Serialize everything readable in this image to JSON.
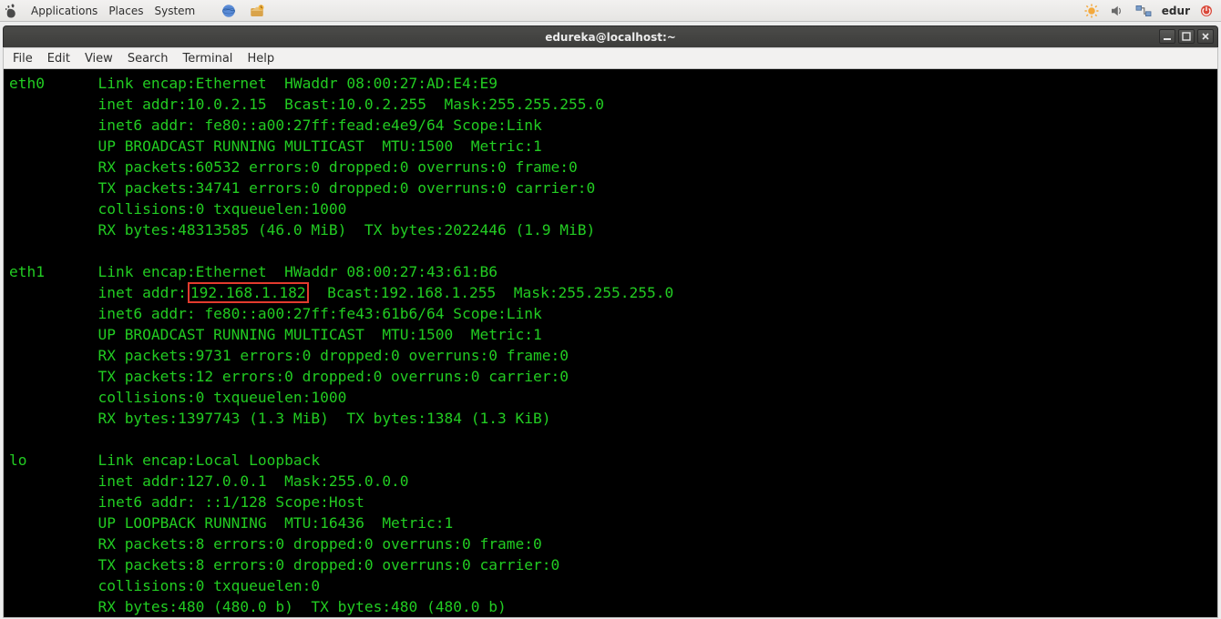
{
  "panel": {
    "menus": {
      "applications": "Applications",
      "places": "Places",
      "system": "System"
    },
    "user": "edur"
  },
  "window": {
    "title": "edureka@localhost:~",
    "menubar": {
      "file": "File",
      "edit": "Edit",
      "view": "View",
      "search": "Search",
      "terminal": "Terminal",
      "help": "Help"
    }
  },
  "highlight_ip": "192.168.1.182",
  "ifaces": [
    {
      "name": "eth0",
      "lines": [
        "Link encap:Ethernet  HWaddr 08:00:27:AD:E4:E9",
        "inet addr:10.0.2.15  Bcast:10.0.2.255  Mask:255.255.255.0",
        "inet6 addr: fe80::a00:27ff:fead:e4e9/64 Scope:Link",
        "UP BROADCAST RUNNING MULTICAST  MTU:1500  Metric:1",
        "RX packets:60532 errors:0 dropped:0 overruns:0 frame:0",
        "TX packets:34741 errors:0 dropped:0 overruns:0 carrier:0",
        "collisions:0 txqueuelen:1000",
        "RX bytes:48313585 (46.0 MiB)  TX bytes:2022446 (1.9 MiB)"
      ]
    },
    {
      "name": "eth1",
      "lines": [
        "Link encap:Ethernet  HWaddr 08:00:27:43:61:B6",
        {
          "pre": "inet addr:",
          "hl": "192.168.1.182",
          "post": "  Bcast:192.168.1.255  Mask:255.255.255.0"
        },
        "inet6 addr: fe80::a00:27ff:fe43:61b6/64 Scope:Link",
        "UP BROADCAST RUNNING MULTICAST  MTU:1500  Metric:1",
        "RX packets:9731 errors:0 dropped:0 overruns:0 frame:0",
        "TX packets:12 errors:0 dropped:0 overruns:0 carrier:0",
        "collisions:0 txqueuelen:1000",
        "RX bytes:1397743 (1.3 MiB)  TX bytes:1384 (1.3 KiB)"
      ]
    },
    {
      "name": "lo",
      "lines": [
        "Link encap:Local Loopback",
        "inet addr:127.0.0.1  Mask:255.0.0.0",
        "inet6 addr: ::1/128 Scope:Host",
        "UP LOOPBACK RUNNING  MTU:16436  Metric:1",
        "RX packets:8 errors:0 dropped:0 overruns:0 frame:0",
        "TX packets:8 errors:0 dropped:0 overruns:0 carrier:0",
        "collisions:0 txqueuelen:0",
        "RX bytes:480 (480.0 b)  TX bytes:480 (480.0 b)"
      ]
    }
  ]
}
